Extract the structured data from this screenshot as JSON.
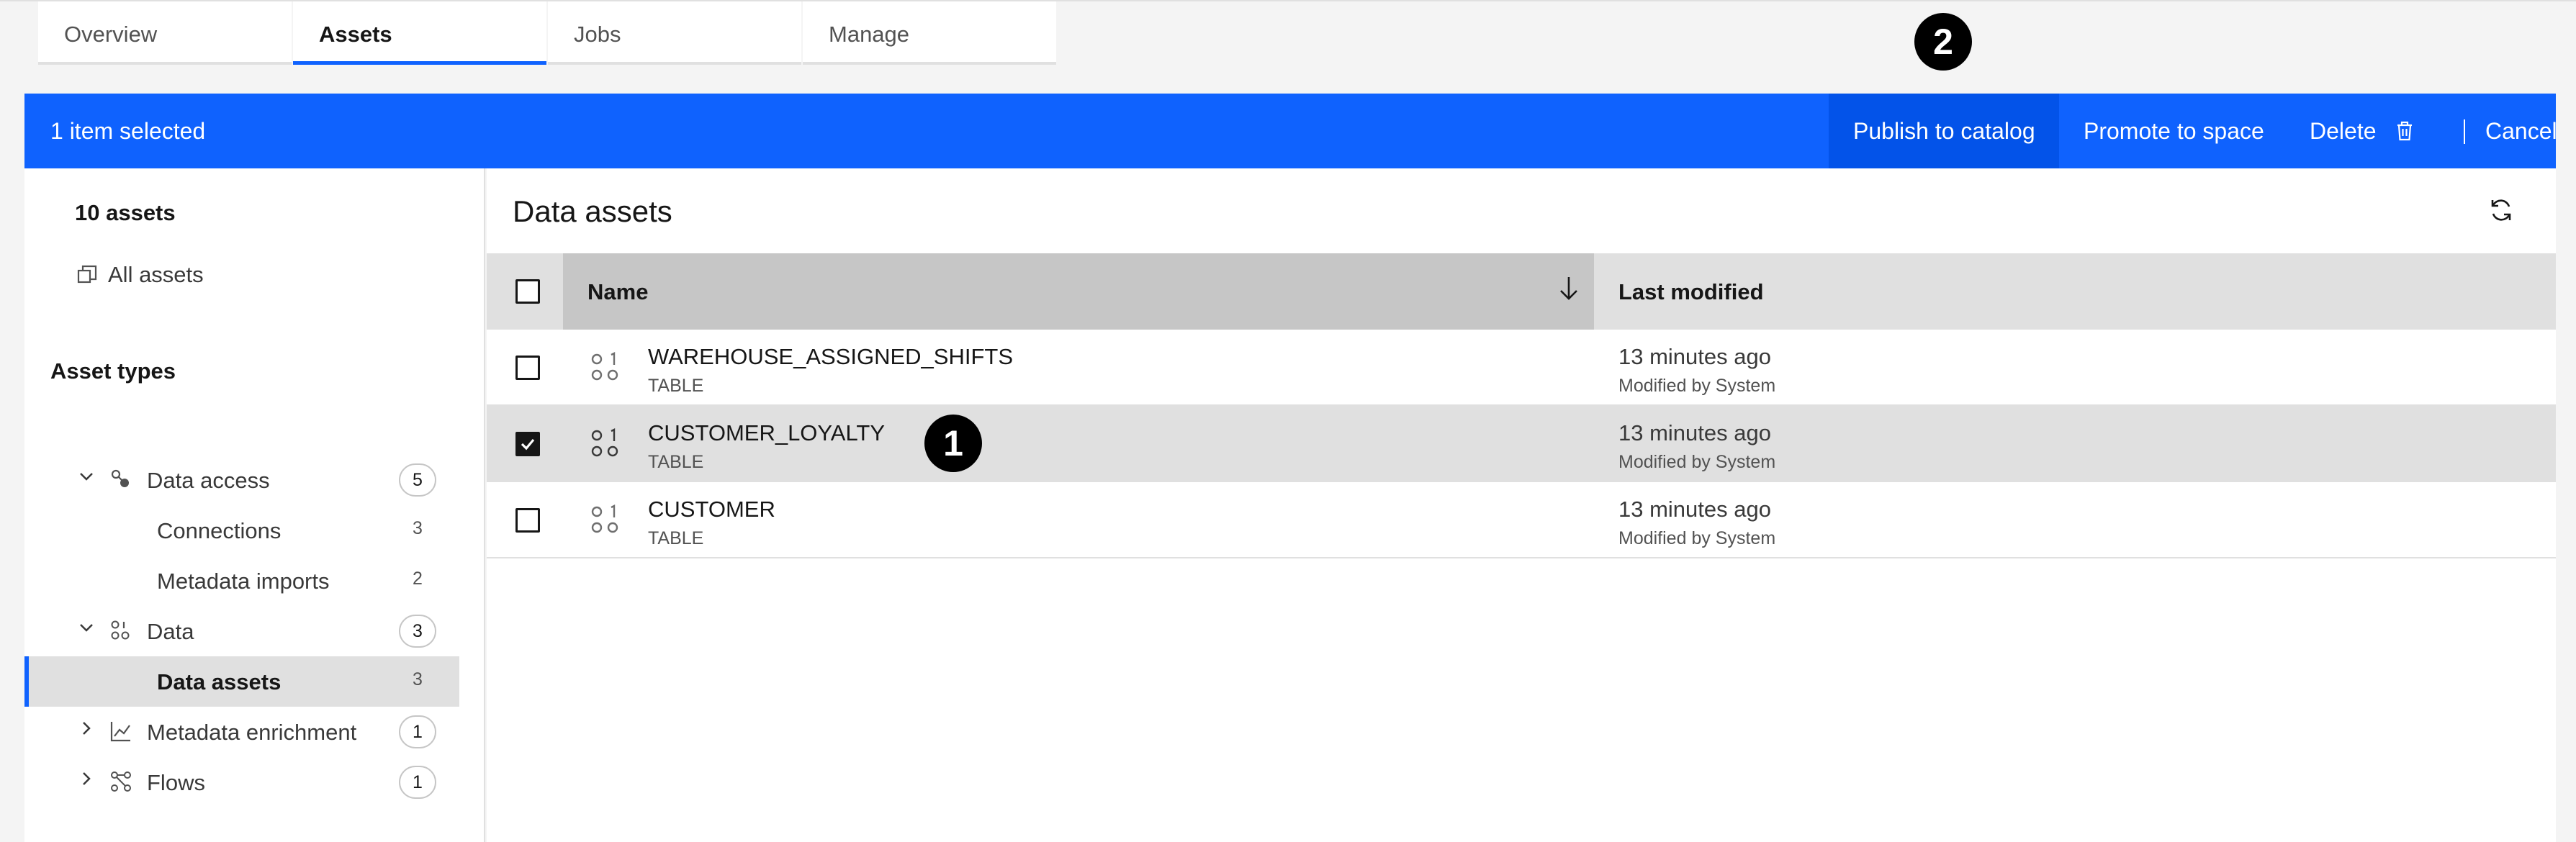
{
  "tabs": [
    {
      "label": "Overview",
      "active": false
    },
    {
      "label": "Assets",
      "active": true
    },
    {
      "label": "Jobs",
      "active": false
    },
    {
      "label": "Manage",
      "active": false
    }
  ],
  "action_bar": {
    "selection_text": "1 item selected",
    "publish_label": "Publish to catalog",
    "promote_label": "Promote to space",
    "delete_label": "Delete",
    "cancel_label": "Cancel",
    "color": "#0f62fe"
  },
  "callouts": [
    "1",
    "2"
  ],
  "left_panel": {
    "count_label": "10 assets",
    "all_assets_label": "All assets",
    "asset_types_heading": "Asset types",
    "tree": [
      {
        "label": "Data access",
        "count": "5",
        "expanded": true,
        "icon": "data-access-icon"
      },
      {
        "label": "Connections",
        "count": "3"
      },
      {
        "label": "Metadata imports",
        "count": "2"
      },
      {
        "label": "Data",
        "count": "3",
        "expanded": true,
        "icon": "data-icon"
      },
      {
        "label": "Data assets",
        "count": "3",
        "selected": true
      },
      {
        "label": "Metadata enrichment",
        "count": "1",
        "expanded": false,
        "icon": "enrichment-icon"
      },
      {
        "label": "Flows",
        "count": "1",
        "expanded": false,
        "icon": "flows-icon"
      }
    ]
  },
  "main": {
    "title": "Data assets",
    "columns": {
      "name": "Name",
      "last_modified": "Last modified"
    },
    "rows": [
      {
        "name": "WAREHOUSE_ASSIGNED_SHIFTS",
        "type": "TABLE",
        "modified": "13 minutes ago",
        "modified_by": "Modified by System",
        "checked": false
      },
      {
        "name": "CUSTOMER_LOYALTY",
        "type": "TABLE",
        "modified": "13 minutes ago",
        "modified_by": "Modified by System",
        "checked": true
      },
      {
        "name": "CUSTOMER",
        "type": "TABLE",
        "modified": "13 minutes ago",
        "modified_by": "Modified by System",
        "checked": false
      }
    ]
  }
}
